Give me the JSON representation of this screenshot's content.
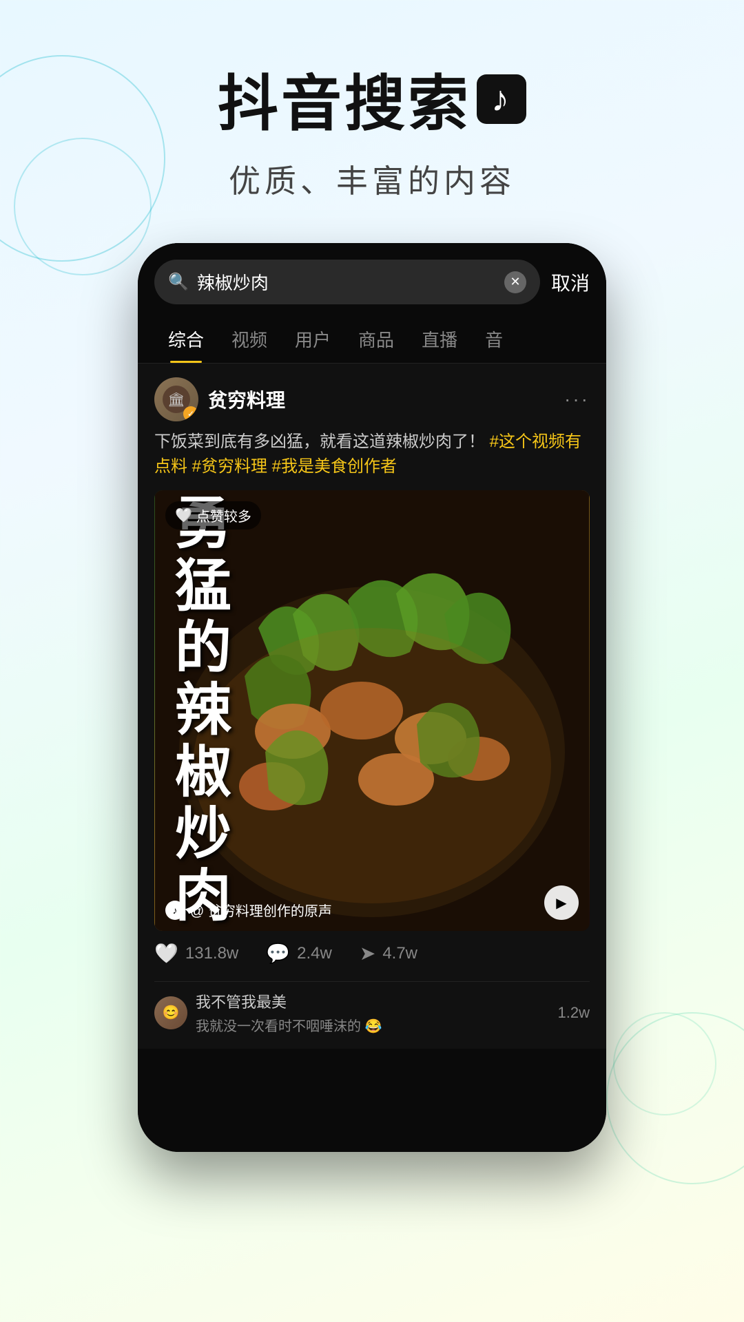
{
  "header": {
    "main_title": "抖音搜索",
    "subtitle": "优质、丰富的内容",
    "tiktok_icon": "♪"
  },
  "phone": {
    "search_bar": {
      "search_icon": "🔍",
      "query": "辣椒炒肉",
      "cancel_label": "取消"
    },
    "tabs": [
      {
        "label": "综合",
        "active": true
      },
      {
        "label": "视频",
        "active": false
      },
      {
        "label": "用户",
        "active": false
      },
      {
        "label": "商品",
        "active": false
      },
      {
        "label": "直播",
        "active": false
      },
      {
        "label": "音",
        "active": false
      }
    ],
    "post": {
      "username": "贫穷料理",
      "verified": true,
      "post_text": "下饭菜到底有多凶猛，就看这道辣椒炒肉了！",
      "hashtags": "#这个视频有点料 #贫穷料理 #我是美食创作者",
      "video_label": "点赞较多",
      "video_overlay": "勇猛的辣椒炒肉",
      "music_text": "@ 贫穷料理创作的原声",
      "likes": "131.8w",
      "comments": "2.4w",
      "shares": "4.7w",
      "comment_preview_text": "我不管我最美",
      "comment_preview_sub": "我就没一次看时不咽唾沫的 😂",
      "comment_count_label": "1.2w"
    }
  }
}
